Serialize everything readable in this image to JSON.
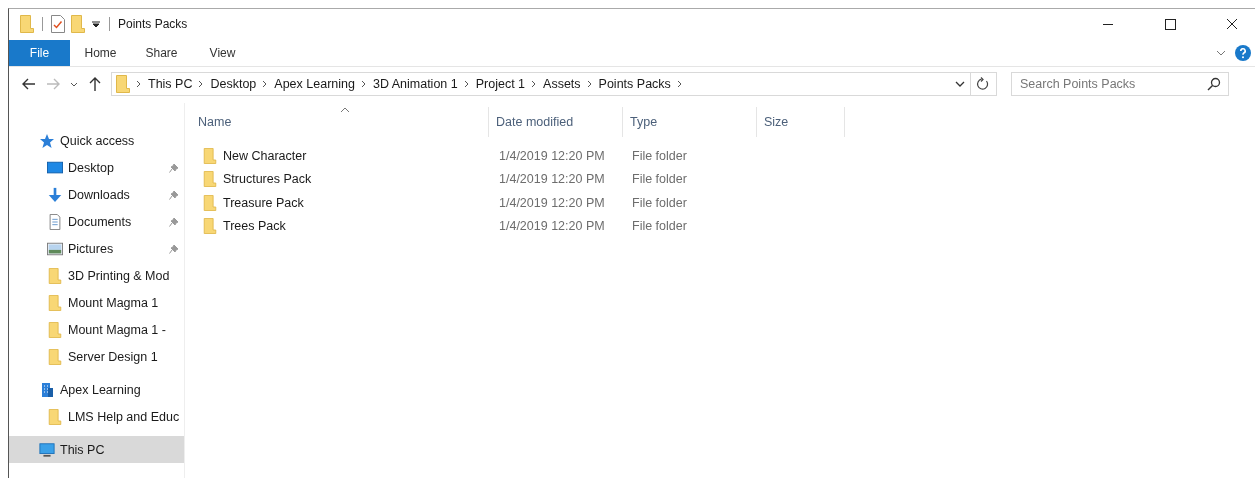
{
  "window": {
    "title": "Points Packs"
  },
  "ribbon_tabs": [
    {
      "label": "File",
      "selected": true
    },
    {
      "label": "Home",
      "selected": false
    },
    {
      "label": "Share",
      "selected": false
    },
    {
      "label": "View",
      "selected": false
    }
  ],
  "breadcrumb": [
    "This PC",
    "Desktop",
    "Apex Learning",
    "3D Animation 1",
    "Project 1",
    "Assets",
    "Points Packs"
  ],
  "search": {
    "placeholder": "Search Points Packs"
  },
  "sidebar": {
    "groups": [
      {
        "label": "Quick access",
        "kind": "star",
        "selected": false,
        "children": [
          {
            "label": "Desktop",
            "kind": "desktop",
            "pinned": true,
            "selected": false
          },
          {
            "label": "Downloads",
            "kind": "download",
            "pinned": true,
            "selected": false
          },
          {
            "label": "Documents",
            "kind": "document",
            "pinned": true,
            "selected": false
          },
          {
            "label": "Pictures",
            "kind": "pictures",
            "pinned": true,
            "selected": false
          },
          {
            "label": "3D Printing  & Mod",
            "kind": "folder",
            "pinned": false,
            "selected": false
          },
          {
            "label": "Mount Magma 1",
            "kind": "folder",
            "pinned": false,
            "selected": false
          },
          {
            "label": "Mount Magma 1 -",
            "kind": "folder",
            "pinned": false,
            "selected": false
          },
          {
            "label": "Server Design 1",
            "kind": "folder",
            "pinned": false,
            "selected": false
          }
        ]
      },
      {
        "label": "Apex Learning",
        "kind": "building",
        "selected": false,
        "children": [
          {
            "label": "LMS Help and Educ",
            "kind": "folder",
            "pinned": false,
            "selected": false
          }
        ]
      },
      {
        "label": "This PC",
        "kind": "pc",
        "selected": true
      }
    ]
  },
  "table": {
    "columns": [
      "Name",
      "Date modified",
      "Type",
      "Size"
    ],
    "rows": [
      {
        "name": "New Character",
        "date_modified": "1/4/2019 12:20 PM",
        "type": "File folder"
      },
      {
        "name": "Structures Pack",
        "date_modified": "1/4/2019 12:20 PM",
        "type": "File folder"
      },
      {
        "name": "Treasure Pack",
        "date_modified": "1/4/2019 12:20 PM",
        "type": "File folder"
      },
      {
        "name": "Trees Pack",
        "date_modified": "1/4/2019 12:20 PM",
        "type": "File folder"
      }
    ]
  }
}
